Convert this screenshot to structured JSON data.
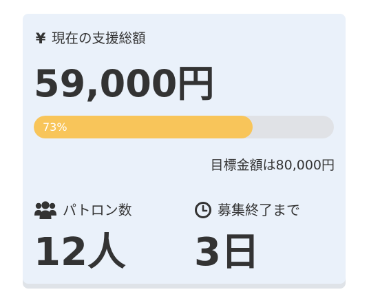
{
  "amount": {
    "icon": "yen-icon",
    "label": "現在の支援総額",
    "value": "59,000円"
  },
  "progress": {
    "percent_text": "73%",
    "fraction": 0.73,
    "fill_color": "#f8c55a",
    "track_color": "#e0e2e6"
  },
  "goal": {
    "text": "目標金額は80,000円"
  },
  "backers": {
    "icon": "users-icon",
    "label": "パトロン数",
    "value": "12人"
  },
  "days_left": {
    "icon": "clock-icon",
    "label": "募集終了まで",
    "value": "3日"
  },
  "colors": {
    "card_background": "#eaf1fa",
    "text": "#333333"
  }
}
